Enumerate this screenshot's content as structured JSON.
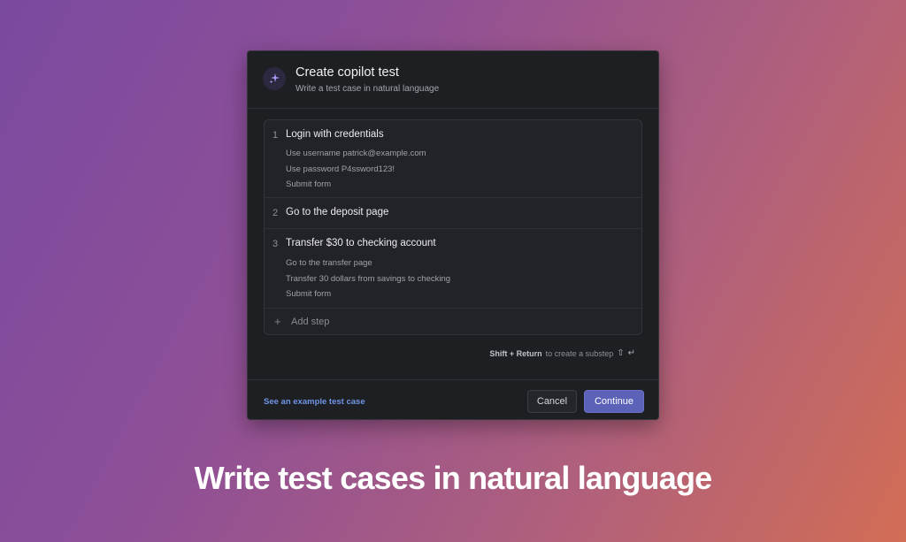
{
  "dialog": {
    "title": "Create copilot test",
    "subtitle": "Write a test case in natural language",
    "icon": "sparkles-icon",
    "steps": [
      {
        "number": "1",
        "title": "Login with credentials",
        "substeps": [
          "Use username patrick@example.com",
          "Use password P4ssword123!",
          "Submit form"
        ]
      },
      {
        "number": "2",
        "title": "Go to the deposit page",
        "substeps": []
      },
      {
        "number": "3",
        "title": "Transfer $30 to checking account",
        "substeps": [
          "Go to the transfer page",
          "Transfer 30 dollars from savings to checking",
          "Submit form"
        ]
      }
    ],
    "add_step_label": "Add step",
    "hint": {
      "keys": "Shift + Return",
      "text": "to create a substep",
      "shift_symbol": "⇧",
      "return_symbol": "↵"
    },
    "footer": {
      "example_link": "See an example test case",
      "cancel_label": "Cancel",
      "continue_label": "Continue"
    }
  },
  "headline": "Write test cases in natural language",
  "colors": {
    "accent": "#5b62b8",
    "link": "#6f95e6",
    "dialog_bg": "#1e1f23"
  }
}
